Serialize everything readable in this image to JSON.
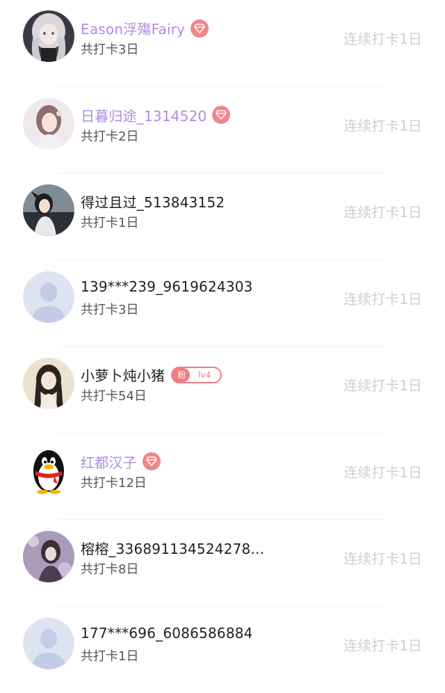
{
  "users": [
    {
      "name": "Eason浮殤Fairy",
      "vip": true,
      "total": "共打卡3日",
      "streak": "连续打卡1日",
      "avatar": "girl-silver-hair-icon"
    },
    {
      "name": "日暮归途_1314520",
      "vip": true,
      "total": "共打卡2日",
      "streak": "连续打卡1日",
      "avatar": "girl-pale-icon"
    },
    {
      "name": "得过且过_513843152",
      "vip": false,
      "total": "共打卡1日",
      "streak": "连续打卡1日",
      "avatar": "girl-dark-icon"
    },
    {
      "name": "139***239_9619624303",
      "vip": false,
      "total": "共打卡3日",
      "streak": "连续打卡1日",
      "avatar": "default-avatar-icon"
    },
    {
      "name": "小萝卜炖小猪",
      "vip": false,
      "fan": {
        "left": "粉",
        "right": "lv4"
      },
      "total": "共打卡54日",
      "streak": "连续打卡1日",
      "avatar": "girl-long-hair-icon"
    },
    {
      "name": "红都汉子",
      "vip": true,
      "total": "共打卡12日",
      "streak": "连续打卡1日",
      "avatar": "qq-penguin-icon"
    },
    {
      "name": "榕榕_336891134524278...",
      "vip": false,
      "total": "共打卡8日",
      "streak": "连续打卡1日",
      "avatar": "girl-purple-icon"
    },
    {
      "name": "177***696_6086586884",
      "vip": false,
      "total": "共打卡1日",
      "streak": "连续打卡1日",
      "avatar": "default-avatar-icon"
    }
  ],
  "colors": {
    "vip_name": "#b18be4",
    "badge": "#f0858a",
    "streak_text": "#cfcfcf"
  }
}
